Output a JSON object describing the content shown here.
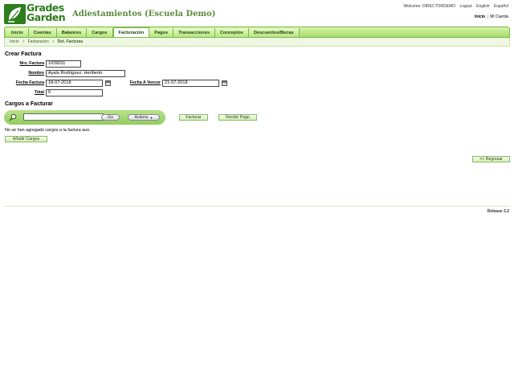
{
  "brand": {
    "logo_line1": "Grades",
    "logo_line2": "Garden",
    "app_title": "Adiestamientos (Escuela Demo)"
  },
  "top_links": {
    "welcome": "Welcome: DIRECTORDEMO",
    "logout": "Logout",
    "english": "English",
    "espanol": "Español"
  },
  "sub_links": {
    "home": "Inicio",
    "separator": "|",
    "account": "Mi Cuenta"
  },
  "nav": {
    "items": [
      {
        "label": "Inicio"
      },
      {
        "label": "Cuentas"
      },
      {
        "label": "Balances"
      },
      {
        "label": "Cargos"
      },
      {
        "label": "Facturación"
      },
      {
        "label": "Pagos"
      },
      {
        "label": "Transacciones"
      },
      {
        "label": "Conceptos"
      },
      {
        "label": "Descuentos/Becas"
      }
    ],
    "active": "Facturación"
  },
  "breadcrumb": {
    "items": [
      "Inicio",
      "Facturación",
      "Det. Facturas"
    ],
    "separator": ">"
  },
  "form": {
    "title": "Crear Factura",
    "invoice_number_label": "Nro. Factura",
    "invoice_number_value": "1039011",
    "name_label": "Nombre",
    "name_value": "Ayala Rodríguez, Heriberto",
    "invoice_date_label": "Fecha Factura",
    "invoice_date_value": "18-07-2018",
    "due_date_label": "Fecha A Vencer",
    "due_date_value": "21-07-2018",
    "total_label": "Total",
    "total_value": "0"
  },
  "charges": {
    "title": "Cargos a Facturar",
    "search_value": "",
    "go_label": "Go",
    "actions_label": "Actions",
    "invoice_button": "Facturar",
    "receive_payment_button": "Recibir Pago",
    "empty_message": "No se han agregado cargos a la factura aun.",
    "add_charges_button": "Añadir Cargos"
  },
  "back_button": "<< Regresar",
  "release": "Release 3.2",
  "colors": {
    "brand_green": "#2e7d1e",
    "nav_green": "#a8dd6c",
    "title_green": "#5a8a3a"
  }
}
